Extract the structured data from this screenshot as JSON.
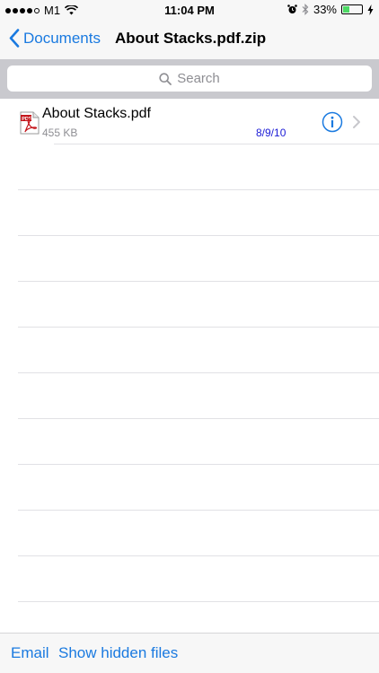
{
  "status": {
    "carrier": "M1",
    "time": "11:04 PM",
    "battery_percent_text": "33%",
    "battery_level": 0.33
  },
  "nav": {
    "back_label": "Documents",
    "title": "About Stacks.pdf.zip"
  },
  "search": {
    "placeholder": "Search"
  },
  "files": [
    {
      "name": "About Stacks.pdf",
      "size": "455 KB",
      "date": "8/9/10",
      "icon": "pdf-file-icon"
    }
  ],
  "toolbar": {
    "email_label": "Email",
    "show_hidden_label": "Show hidden files"
  },
  "colors": {
    "accent": "#1a7ae0",
    "date": "#1b1bd6",
    "pdf": "#c4161c"
  }
}
